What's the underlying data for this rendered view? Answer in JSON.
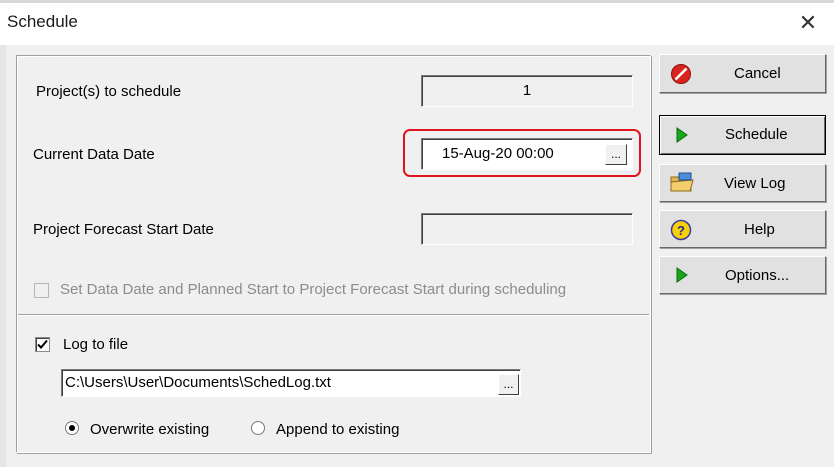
{
  "window": {
    "title": "Schedule",
    "close_icon": "close-icon"
  },
  "fields": {
    "projects_label": "Project(s) to schedule",
    "projects_value": "1",
    "data_date_label": "Current Data Date",
    "data_date_value": "15-Aug-20 00:00",
    "forecast_label": "Project Forecast Start Date",
    "forecast_value": "",
    "ellipsis": "...",
    "set_data_date_label": "Set Data Date and Planned Start to Project Forecast Start during scheduling",
    "set_data_date_checked": false
  },
  "log": {
    "log_to_file_label": "Log to file",
    "log_to_file_checked": true,
    "path": "C:\\Users\\User\\Documents\\SchedLog.txt",
    "overwrite_label": "Overwrite existing",
    "append_label": "Append to existing",
    "selected_mode": "overwrite"
  },
  "buttons": {
    "cancel": "Cancel",
    "schedule": "Schedule",
    "view_log": "View Log",
    "help": "Help",
    "options": "Options..."
  },
  "colors": {
    "highlight": "#e0141e",
    "cancel_icon": "#d9231f",
    "play_icon": "#1aa51a",
    "help_icon": "#f5d10a"
  }
}
